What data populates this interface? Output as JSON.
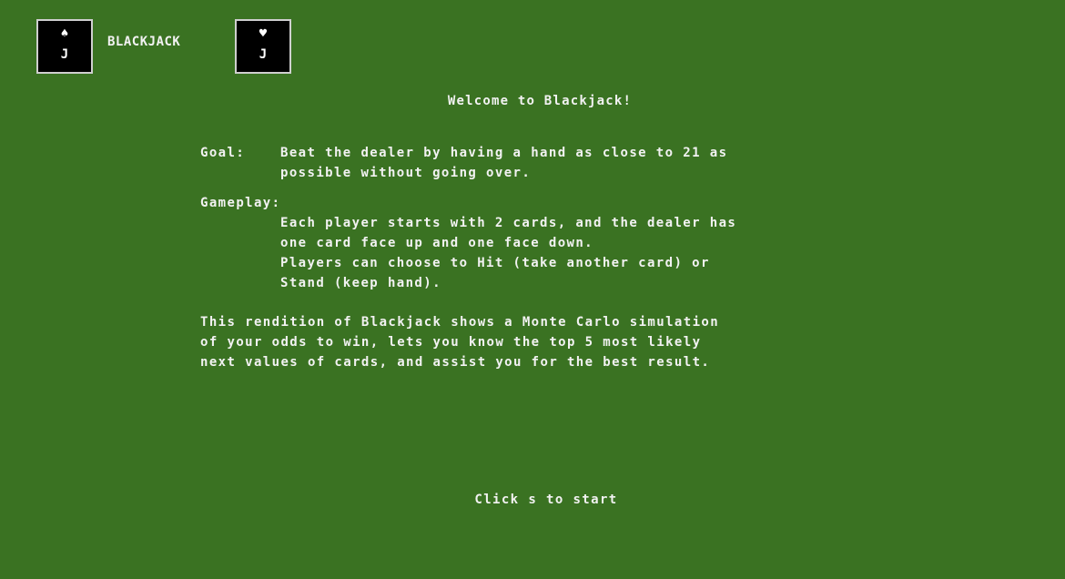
{
  "header": {
    "title": "BLACKJACK",
    "card_left": {
      "suit_icon": "spade-icon",
      "suit": "♠",
      "rank": "J"
    },
    "card_right": {
      "suit_icon": "heart-icon",
      "suit": "♥",
      "rank": "J"
    }
  },
  "welcome": "Welcome to Blackjack!",
  "goal": {
    "label": "Goal:",
    "text": "Beat the dealer by having a hand as close to 21 as\npossible without going over."
  },
  "gameplay": {
    "label": "Gameplay:",
    "text": "Each player starts with 2 cards, and the dealer has\none card face up and one face down.\nPlayers can choose to Hit (take another card) or\nStand (keep hand)."
  },
  "description": "This rendition of Blackjack shows a Monte Carlo simulation\nof your odds to win, lets you know the top 5 most likely\nnext values of cards, and assist you for the best result.",
  "start_prompt": "Click s to start",
  "colors": {
    "background": "#3a7222",
    "text": "#f2f2f2",
    "card": "#000000"
  }
}
